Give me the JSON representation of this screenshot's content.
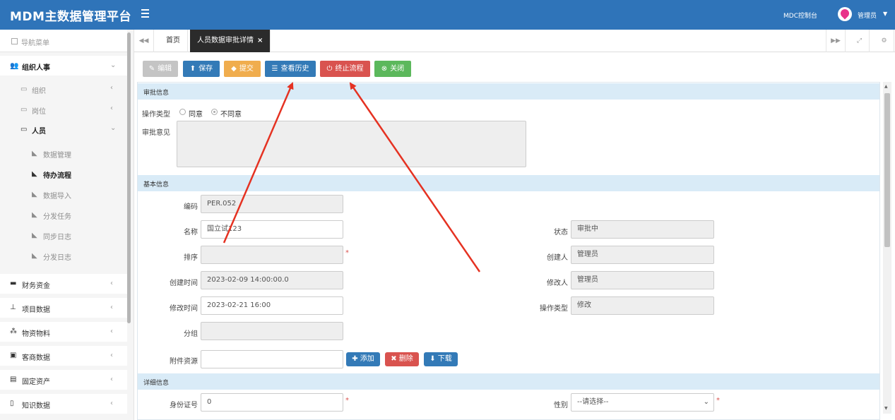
{
  "app": {
    "title": "MDM主数据管理平台",
    "console": "MDC控制台",
    "user": "管理员"
  },
  "sidebar": {
    "nav_title": "导航菜单",
    "groups": [
      {
        "label": "组织人事"
      },
      {
        "label": "组织"
      },
      {
        "label": "岗位"
      },
      {
        "label": "人员"
      },
      {
        "label": "数据管理"
      },
      {
        "label": "待办流程"
      },
      {
        "label": "数据导入"
      },
      {
        "label": "分发任务"
      },
      {
        "label": "同步日志"
      },
      {
        "label": "分发日志"
      },
      {
        "label": "财务资金"
      },
      {
        "label": "项目数据"
      },
      {
        "label": "物资物料"
      },
      {
        "label": "客商数据"
      },
      {
        "label": "固定资产"
      },
      {
        "label": "知识数据"
      }
    ]
  },
  "tabs": {
    "home": "首页",
    "active": "人员数据审批详情",
    "close": "×"
  },
  "toolbar": {
    "edit": "编辑",
    "save": "保存",
    "submit": "提交",
    "history": "查看历史",
    "terminate": "终止流程",
    "close": "关闭"
  },
  "approval": {
    "section": "审批信息",
    "op_type_label": "操作类型",
    "agree": "同意",
    "disagree": "不同意",
    "opinion_label": "审批意见"
  },
  "basic": {
    "section": "基本信息",
    "code_label": "编码",
    "code_value": "PER.052",
    "name_label": "名称",
    "name_value": "国立试123",
    "sort_label": "排序",
    "sort_value": "",
    "created_label": "创建时间",
    "created_value": "2023-02-09 14:00:00.0",
    "modified_label": "修改时间",
    "modified_value": "2023-02-21 16:00",
    "group_label": "分组",
    "group_value": "",
    "attach_label": "附件资源",
    "add": "添加",
    "delete": "删除",
    "download": "下载",
    "status_label": "状态",
    "status_value": "审批中",
    "creator_label": "创建人",
    "creator_value": "管理员",
    "modifier_label": "修改人",
    "modifier_value": "管理员",
    "optype_label": "操作类型",
    "optype_value": "修改"
  },
  "detail": {
    "section": "详细信息",
    "id_label": "身份证号",
    "id_value": "0",
    "gender_label": "性别",
    "gender_value": "--请选择--"
  },
  "colors": {
    "primary": "#2f74b9",
    "save": "#337ab7",
    "submit": "#f0ad4e",
    "terminate": "#d9534f",
    "close": "#5cb85c",
    "edit": "#c4c4c4",
    "arrow": "#e53222"
  }
}
